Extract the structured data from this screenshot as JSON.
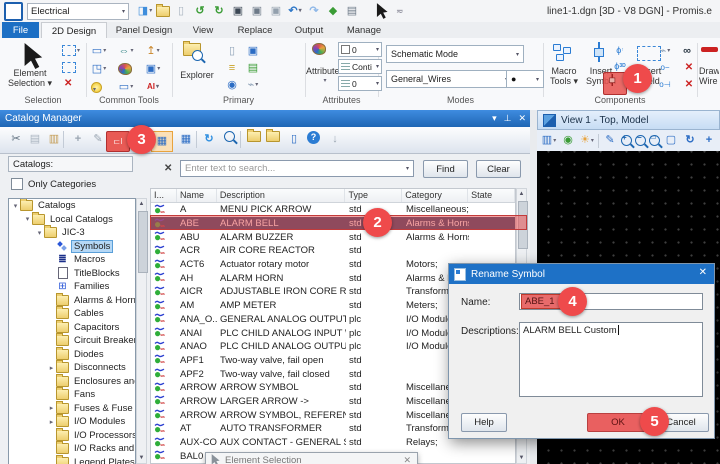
{
  "titlebar": {
    "workspace": "Electrical",
    "title": "line1-1.dgn [3D - V8 DGN] - Promis.e",
    "icons": [
      {
        "name": "workspace-config-icon",
        "glyph": "◨",
        "color": "#3f8edc",
        "dd": true
      },
      {
        "name": "open-folder-icon",
        "glyph": "fld"
      },
      {
        "name": "new-file-icon",
        "glyph": "▯",
        "color": "#a9b4bf"
      },
      {
        "name": "import-file-icon",
        "glyph": "↺",
        "color": "#3a9c35",
        "bold": true
      },
      {
        "name": "export-file-icon",
        "glyph": "↻",
        "color": "#3a9c35",
        "bold": true
      },
      {
        "name": "save-icon",
        "glyph": "▣",
        "color": "#3b4754"
      },
      {
        "name": "save-settings-icon",
        "glyph": "▣",
        "color": "#6d7a88"
      },
      {
        "name": "save-as-icon",
        "glyph": "▣",
        "color": "#93a0ad"
      },
      {
        "name": "undo-icon",
        "glyph": "↶",
        "color": "#2f78c8",
        "bold": true,
        "dd": true
      },
      {
        "name": "redo-icon",
        "glyph": "↷",
        "color": "#8fb8e8",
        "bold": true
      },
      {
        "name": "pin-icon",
        "glyph": "◆",
        "color": "#3a9c35"
      },
      {
        "name": "print-icon",
        "glyph": "▤",
        "color": "#6d7a88"
      }
    ]
  },
  "tabs": [
    {
      "label": "File",
      "file": true
    },
    {
      "label": "2D Design",
      "active": true
    },
    {
      "label": "Panel Design"
    },
    {
      "label": "View"
    },
    {
      "label": "Replace"
    },
    {
      "label": "Output"
    },
    {
      "label": "Manage"
    }
  ],
  "ribbon": {
    "groups": [
      "Selection",
      "Common Tools",
      "Primary",
      "Attributes",
      "Modes",
      "Components"
    ],
    "selection": {
      "l1": "Element",
      "l2": "Selection ▾"
    },
    "explorer": "Explorer",
    "attributes_btn": "Attributes",
    "attr_color": "0",
    "attr_style": "Conti",
    "attr_weight": "0",
    "mode": "Schematic Mode",
    "wire": "General_Wires",
    "macro": {
      "l1": "Macro",
      "l2": "Tools ▾"
    },
    "insert_symbol": {
      "l1": "Insert",
      "l2": "Symbol"
    },
    "insert_field": {
      "l1": "Insert",
      "l2": "Field"
    },
    "draw_wire": {
      "l1": "Draw",
      "l2": "Wire"
    },
    "common_icons": [
      {
        "name": "fence-icon",
        "glyph": "▭",
        "color": "#2b6cc4",
        "dd": true
      },
      {
        "name": "measure-icon",
        "glyph": "⇔",
        "color": "#3a8a8a",
        "dd": true
      },
      {
        "name": "manipulate-icon",
        "glyph": "↥",
        "color": "#c9862a",
        "dd": true
      },
      {
        "name": "modify-icon",
        "glyph": "◳",
        "color": "#2b6cc4",
        "dd": true
      },
      {
        "name": "palette-icon",
        "glyph": "palette",
        "dd": true
      },
      {
        "name": "cell-tools-icon",
        "glyph": "▣",
        "color": "#2b6cc4",
        "dd": true
      },
      {
        "name": "bulb-icon",
        "glyph": "bulb",
        "dd": true
      },
      {
        "name": "shapes-icon",
        "glyph": "▭",
        "color": "#2b6cc4",
        "dd": true
      },
      {
        "name": "place-text-icon",
        "glyph": "AI",
        "color": "#cc2222",
        "bold": true,
        "fs": 8,
        "dd": true
      }
    ],
    "primary_icons": [
      {
        "name": "new-doc-icon",
        "glyph": "▯",
        "color": "#8fa3b8"
      },
      {
        "name": "models-icon",
        "glyph": "▣",
        "color": "#2b6cc4"
      },
      {
        "name": "levels-icon",
        "glyph": "≡",
        "color": "#c9a227",
        "bold": true
      },
      {
        "name": "reference-icon",
        "glyph": "▤",
        "color": "#3a9c35"
      },
      {
        "name": "item-info-icon",
        "glyph": "◉",
        "color": "#2b6cc4"
      },
      {
        "name": "connect-icon",
        "glyph": "⌁",
        "color": "#8fa3b8",
        "dd": true
      }
    ]
  },
  "catalog_manager": {
    "title": "Catalog Manager",
    "toolbar": [
      {
        "name": "cut-icon",
        "glyph": "✂",
        "color": "#5a6b7a"
      },
      {
        "name": "copy-icon",
        "glyph": "▤",
        "color": "#a9b4bf"
      },
      {
        "name": "paste-icon",
        "glyph": "▥",
        "color": "#c39b52"
      },
      {
        "sep": true
      },
      {
        "name": "add-icon",
        "glyph": "+",
        "color": "#9aa5b1",
        "bold": true
      },
      {
        "name": "edit-icon",
        "glyph": "✎",
        "color": "#9aa5b1"
      },
      {
        "name": "rename-icon",
        "glyph": "⊏I",
        "color": "#fbe6e2",
        "hl": "red",
        "fs": 8
      },
      {
        "name": "grid-view-icon",
        "glyph": "▦",
        "color": "#2b6cc4",
        "hl": "orange"
      },
      {
        "name": "list-view-icon",
        "glyph": "▦",
        "color": "#2b6cc4"
      },
      {
        "sep": true
      },
      {
        "name": "refresh-icon",
        "glyph": "↻",
        "color": "#2f8fe0",
        "bold": true
      },
      {
        "name": "search-icon",
        "glyph": "mag"
      },
      {
        "sep": true
      },
      {
        "name": "import-symbols-icon",
        "glyph": "fld"
      },
      {
        "name": "export-symbols-icon",
        "glyph": "fld"
      },
      {
        "name": "report-icon",
        "glyph": "▯",
        "color": "#2b6cc4"
      },
      {
        "name": "help-icon",
        "glyph": "?",
        "cls": "helpc"
      },
      {
        "name": "download-icon",
        "glyph": "↓",
        "color": "#9aa5b1",
        "bold": true
      }
    ],
    "catalogs_label": "Catalogs:",
    "only_categories": "Only Categories",
    "search_placeholder": "Enter text to search...",
    "find": "Find",
    "clear": "Clear",
    "tree": [
      {
        "label": "Catalogs",
        "depth": 0,
        "icon": "folder",
        "arrow": "open"
      },
      {
        "label": "Local Catalogs",
        "depth": 1,
        "icon": "folder",
        "arrow": "open"
      },
      {
        "label": "JIC-3",
        "depth": 2,
        "icon": "folder",
        "arrow": "open"
      },
      {
        "label": "Symbols",
        "depth": 3,
        "icon": "symbols",
        "selected": true
      },
      {
        "label": "Macros",
        "depth": 3,
        "icon": "macros"
      },
      {
        "label": "TitleBlocks",
        "depth": 3,
        "icon": "titleblocks"
      },
      {
        "label": "Families",
        "depth": 3,
        "icon": "families"
      },
      {
        "label": "Alarms & Horns",
        "depth": 3,
        "icon": "folder"
      },
      {
        "label": "Cables",
        "depth": 3,
        "icon": "folder"
      },
      {
        "label": "Capacitors",
        "depth": 3,
        "icon": "folder"
      },
      {
        "label": "Circuit Breakers",
        "depth": 3,
        "icon": "folder"
      },
      {
        "label": "Diodes",
        "depth": 3,
        "icon": "folder"
      },
      {
        "label": "Disconnects",
        "depth": 3,
        "icon": "folder",
        "arrow": "closed"
      },
      {
        "label": "Enclosures and Ac",
        "depth": 3,
        "icon": "folder"
      },
      {
        "label": "Fans",
        "depth": 3,
        "icon": "folder"
      },
      {
        "label": "Fuses & Fuse Bloc",
        "depth": 3,
        "icon": "folder",
        "arrow": "closed"
      },
      {
        "label": "I/O Modules",
        "depth": 3,
        "icon": "folder",
        "arrow": "closed"
      },
      {
        "label": "I/O Processors",
        "depth": 3,
        "icon": "folder"
      },
      {
        "label": "I/O Racks and Pov",
        "depth": 3,
        "icon": "folder"
      },
      {
        "label": "Legend Plates",
        "depth": 3,
        "icon": "folder"
      }
    ],
    "columns": [
      "I...",
      "Name",
      "Description",
      "Type",
      "Category",
      "State"
    ],
    "rows": [
      {
        "name": "A",
        "desc": "MENU PICK ARROW",
        "type": "std",
        "cat": "Miscellaneous;",
        "state": ""
      },
      {
        "name": "ABE",
        "desc": "ALARM BELL",
        "type": "std",
        "cat": "Alarms & Horns;",
        "state": "",
        "selected": true
      },
      {
        "name": "ABU",
        "desc": "ALARM BUZZER",
        "type": "std",
        "cat": "Alarms & Horns;",
        "state": ""
      },
      {
        "name": "ACR",
        "desc": "AIR CORE REACTOR",
        "type": "std",
        "cat": "",
        "state": ""
      },
      {
        "name": "ACT6",
        "desc": "Actuator rotary motor",
        "type": "std",
        "cat": "Motors;",
        "state": ""
      },
      {
        "name": "AH",
        "desc": "ALARM HORN",
        "type": "std",
        "cat": "Alarms & Horns;",
        "state": ""
      },
      {
        "name": "AICR",
        "desc": "ADJUSTABLE IRON CORE REAC...",
        "type": "std",
        "cat": "Transformers;",
        "state": ""
      },
      {
        "name": "AM",
        "desc": "AMP METER",
        "type": "std",
        "cat": "Meters;",
        "state": ""
      },
      {
        "name": "ANA_O...",
        "desc": "GENERAL ANALOG OUTPUT",
        "type": "plc",
        "cat": "I/O Modules;",
        "state": ""
      },
      {
        "name": "ANAI",
        "desc": "PLC CHILD ANALOG INPUT WIT...",
        "type": "plc",
        "cat": "I/O Modules;",
        "state": ""
      },
      {
        "name": "ANAO",
        "desc": "PLC CHILD ANALOG OUTPUT WI...",
        "type": "plc",
        "cat": "I/O Modules;",
        "state": ""
      },
      {
        "name": "APF1",
        "desc": "Two-way valve, fail open",
        "type": "std",
        "cat": "",
        "state": ""
      },
      {
        "name": "APF2",
        "desc": "Two-way valve, fail closed",
        "type": "std",
        "cat": "",
        "state": ""
      },
      {
        "name": "ARROW",
        "desc": "ARROW SYMBOL",
        "type": "std",
        "cat": "Miscellaneous;",
        "state": ""
      },
      {
        "name": "ARROW1",
        "desc": "LARGER ARROW ->",
        "type": "std",
        "cat": "Miscellaneous;",
        "state": ""
      },
      {
        "name": "ARROW2",
        "desc": "ARROW SYMBOL, REFERENCE P...",
        "type": "std",
        "cat": "Miscellaneous;",
        "state": ""
      },
      {
        "name": "AT",
        "desc": "AUTO TRANSFORMER",
        "type": "std",
        "cat": "Transformers;",
        "state": ""
      },
      {
        "name": "AUX-CON",
        "desc": "AUX CONTACT - GENERAL SYMB...",
        "type": "std",
        "cat": "Relays;",
        "state": ""
      },
      {
        "name": "BAL0",
        "desc": "",
        "type": "std",
        "cat": "",
        "state": ""
      }
    ]
  },
  "view": {
    "title": "View 1 - Top, Model",
    "toolbar": [
      {
        "name": "view-display-icon",
        "glyph": "▥",
        "color": "#2b6cc4",
        "dd": true
      },
      {
        "name": "view-groups-icon",
        "glyph": "◉",
        "color": "#3a9c35"
      },
      {
        "name": "lighting-icon",
        "glyph": "☀",
        "color": "#e8a33d",
        "dd": true
      },
      {
        "sep": true
      },
      {
        "name": "brush-icon",
        "glyph": "✎",
        "color": "#2b6cc4"
      },
      {
        "name": "zoom-in-icon",
        "glyph": "mag+"
      },
      {
        "name": "zoom-out-icon",
        "glyph": "mag-"
      },
      {
        "name": "zoom-window-icon",
        "glyph": "magr"
      },
      {
        "name": "fit-view-icon",
        "glyph": "▢",
        "color": "#2b6cc4"
      },
      {
        "name": "rotate-view-icon",
        "glyph": "↻",
        "color": "#2b6cc4",
        "bold": true
      },
      {
        "name": "pan-view-icon",
        "glyph": "+",
        "color": "#2b6cc4",
        "bold": true
      }
    ]
  },
  "dialog": {
    "title": "Rename Symbol",
    "name_label": "Name:",
    "name_value": "ABE_1",
    "desc_label": "Descriptions:",
    "desc_value": "ALARM BELL Custom",
    "help": "Help",
    "ok": "OK",
    "cancel": "Cancel"
  },
  "popup": {
    "title": "Element Selection"
  },
  "annotations": [
    "1",
    "2",
    "3",
    "4",
    "5"
  ],
  "colors": {
    "accent": "#1c6fc4",
    "panel_title": "#2f7fd6",
    "annotation": "#ef4a4b",
    "selection_row": "#1b3c66",
    "highlight": "#e86b6b"
  }
}
